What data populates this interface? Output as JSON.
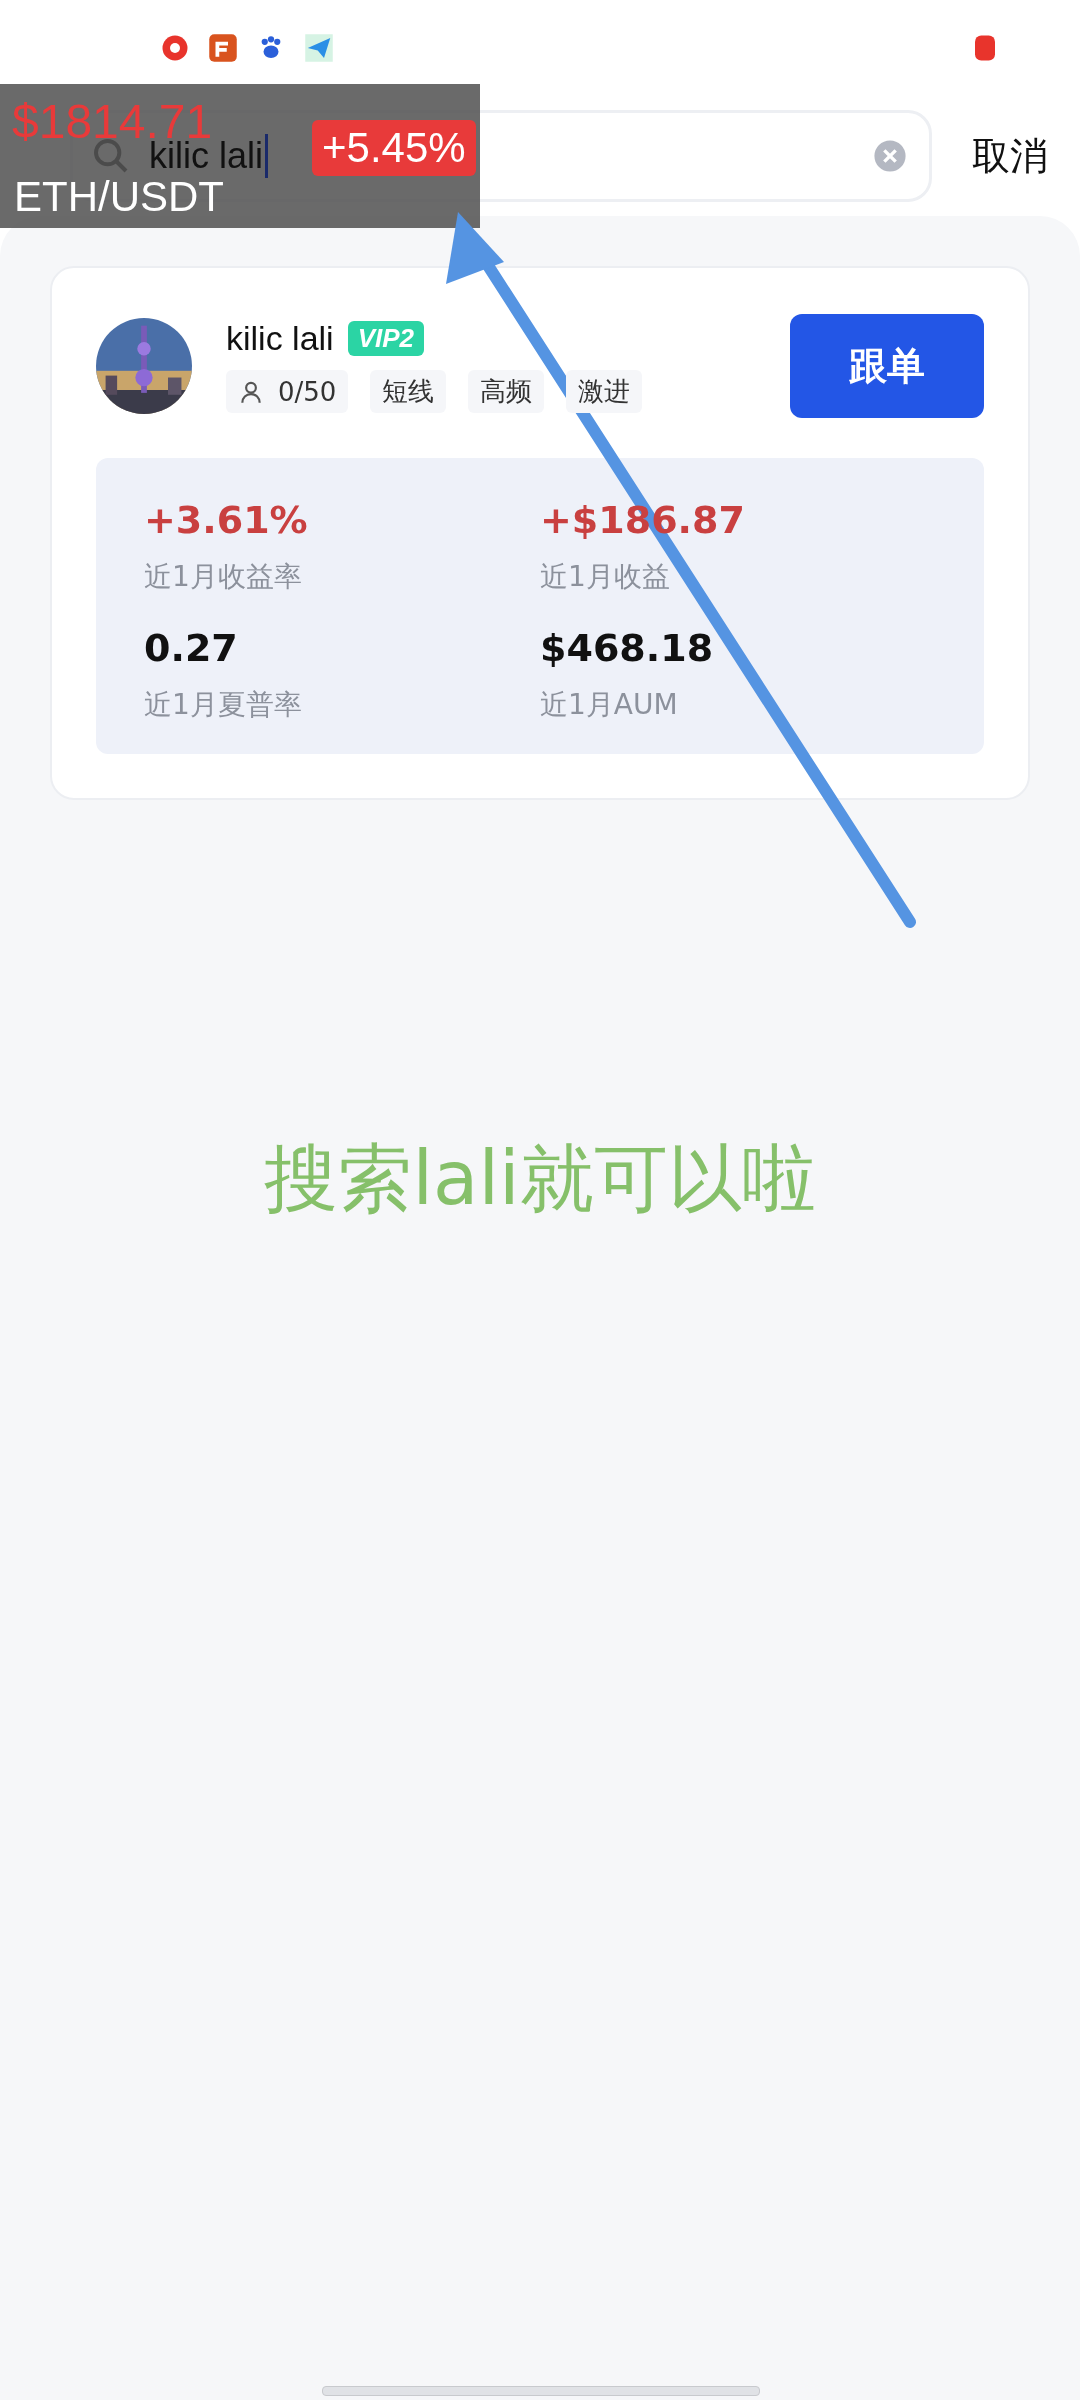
{
  "search": {
    "value": "kilic lali",
    "focused": true
  },
  "cancel_button": "取消",
  "trader": {
    "name": "kilic lali",
    "badge": "VIP2",
    "followers": "0/50",
    "tags": [
      "短线",
      "高频",
      "激进"
    ],
    "follow_button": "跟单",
    "stats": [
      {
        "value": "+3.61%",
        "label": "近1月收益率",
        "gain": true
      },
      {
        "value": "+$186.87",
        "label": "近1月收益",
        "gain": true
      },
      {
        "value": "0.27",
        "label": "近1月夏普率",
        "gain": false
      },
      {
        "value": "$468.18",
        "label": "近1月AUM",
        "gain": false
      }
    ]
  },
  "price_overlay": {
    "price": "$1814.71",
    "pair": "ETH/USDT",
    "change": "+5.45%"
  },
  "annotation": "搜索lali就可以啦"
}
